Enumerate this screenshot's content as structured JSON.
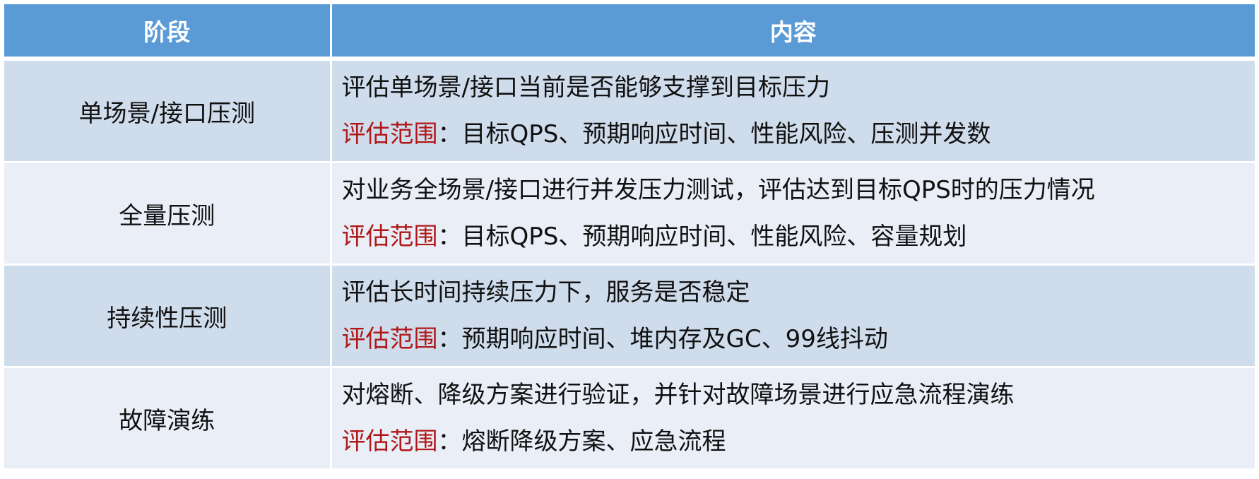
{
  "header": {
    "stage": "阶段",
    "content": "内容"
  },
  "rows": [
    {
      "stage": "单场景/接口压测",
      "desc": "评估单场景/接口当前是否能够支撑到目标压力",
      "scope_label": "评估范围",
      "scope_text": "：目标QPS、预期响应时间、性能风险、压测并发数"
    },
    {
      "stage": "全量压测",
      "desc": "对业务全场景/接口进行并发压力测试，评估达到目标QPS时的压力情况",
      "scope_label": "评估范围",
      "scope_text": "：目标QPS、预期响应时间、性能风险、容量规划"
    },
    {
      "stage": "持续性压测",
      "desc": "评估长时间持续压力下，服务是否稳定",
      "scope_label": "评估范围",
      "scope_text": "：预期响应时间、堆内存及GC、99线抖动"
    },
    {
      "stage": "故障演练",
      "desc": "对熔断、降级方案进行验证，并针对故障场景进行应急流程演练",
      "scope_label": "评估范围",
      "scope_text": "：熔断降级方案、应急流程"
    }
  ],
  "colors": {
    "header_bg": "#5b9bd5",
    "row_dark": "#cfdcec",
    "row_light": "#e9eef7",
    "scope_label": "#b01818"
  }
}
